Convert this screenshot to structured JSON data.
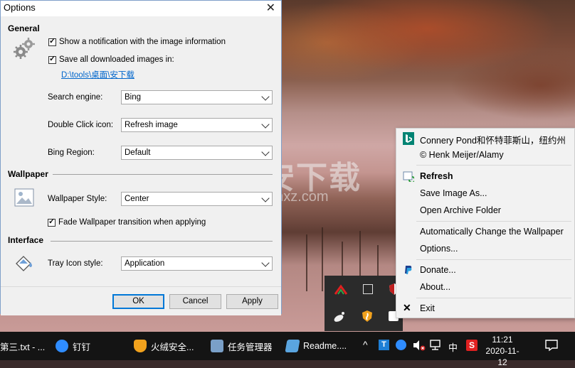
{
  "dialog": {
    "title": "Options",
    "close_glyph": "✕",
    "general": {
      "heading": "General",
      "show_notification": "Show a notification with the image information",
      "save_images": "Save all downloaded images in:",
      "save_path": "D:\\tools\\桌面\\安下载",
      "search_engine_label": "Search engine:",
      "search_engine_value": "Bing",
      "double_click_label": "Double Click icon:",
      "double_click_value": "Refresh image",
      "region_label": "Bing Region:",
      "region_value": "Default"
    },
    "wallpaper": {
      "heading": "Wallpaper",
      "style_label": "Wallpaper Style:",
      "style_value": "Center",
      "fade_label": "Fade Wallpaper transition when applying"
    },
    "interface": {
      "heading": "Interface",
      "tray_label": "Tray Icon style:",
      "tray_value": "Application"
    },
    "buttons": {
      "ok": "OK",
      "cancel": "Cancel",
      "apply": "Apply"
    }
  },
  "watermark": {
    "text": "安下载",
    "sub": "anxz.com"
  },
  "context_menu": {
    "image_title": "Connery Pond和怀特菲斯山，纽约州",
    "copyright": "© Henk Meijer/Alamy",
    "refresh": "Refresh",
    "save_as": "Save Image As...",
    "open_archive": "Open Archive Folder",
    "auto_change": "Automatically Change the Wallpaper",
    "options": "Options...",
    "donate": "Donate...",
    "about": "About...",
    "exit": "Exit",
    "exit_glyph": "✕"
  },
  "taskbar": {
    "items": [
      {
        "label": "第三.txt - ...",
        "color": "#cfd8e3"
      },
      {
        "label": "钉钉",
        "color": "#2f8cff"
      },
      {
        "label": "火绒安全...",
        "color": "#f2a21d"
      },
      {
        "label": "任务管理器",
        "color": "#7aa0c8"
      },
      {
        "label": "Readme....",
        "color": "#5aa5e0"
      }
    ],
    "tray": {
      "chevron": "^",
      "ime": "中",
      "antivirus_letter": "S",
      "t_letter": "T"
    },
    "time": "11:21",
    "date": "2020-11-12",
    "notification_glyph": "▭"
  },
  "colors": {
    "accent": "#0078d7",
    "link": "#0066cc",
    "bing": "#008373",
    "taskbar": "#141414"
  }
}
